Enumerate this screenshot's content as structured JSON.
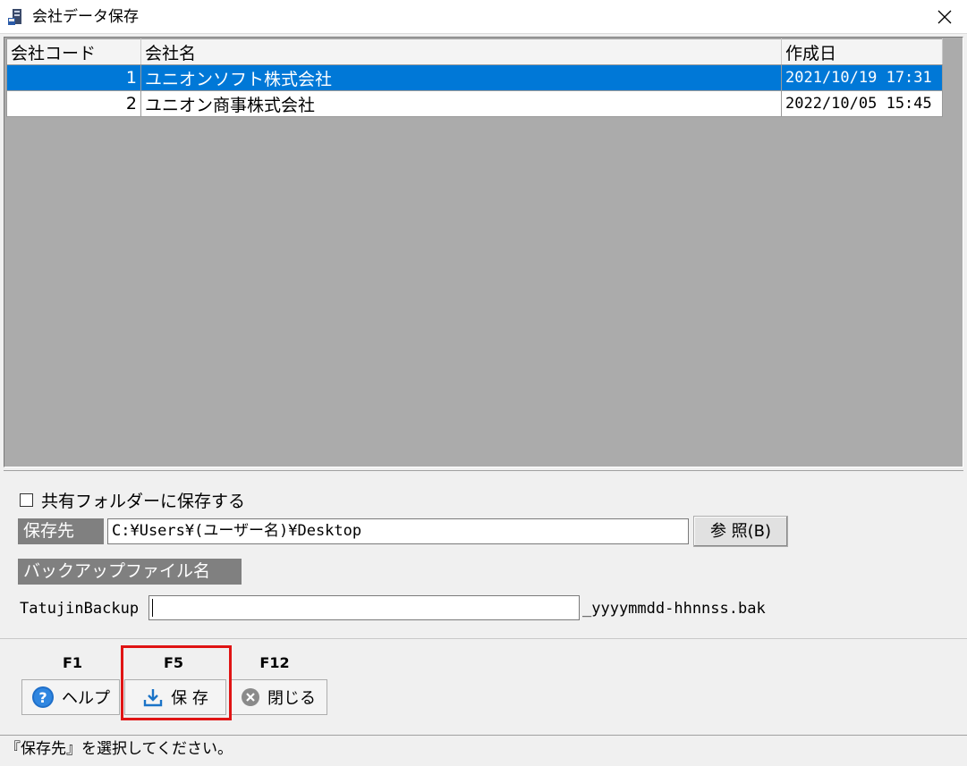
{
  "window": {
    "title": "会社データ保存"
  },
  "grid": {
    "headers": {
      "code": "会社コード",
      "name": "会社名",
      "date": "作成日"
    },
    "rows": [
      {
        "code": "1",
        "name": "ユニオンソフト株式会社",
        "date": "2021/10/19 17:31",
        "selected": true
      },
      {
        "code": "2",
        "name": "ユニオン商事株式会社",
        "date": "2022/10/05 15:45",
        "selected": false
      }
    ]
  },
  "options": {
    "shared_folder_label": "共有フォルダーに保存する",
    "shared_folder_checked": false,
    "destination_label": "保存先",
    "destination_value": "C:¥Users¥(ユーザー名)¥Desktop",
    "browse_label": "参 照(B)",
    "backup_name_label": "バックアップファイル名",
    "backup_prefix": "TatujinBackup",
    "backup_name_value": "",
    "backup_suffix": "_yyyymmdd-hhnnss.bak"
  },
  "function_keys": {
    "f1": {
      "key": "F1",
      "label": "ヘルプ",
      "icon": "help-icon"
    },
    "f5": {
      "key": "F5",
      "label": "保 存",
      "icon": "download-icon"
    },
    "f12": {
      "key": "F12",
      "label": "閉じる",
      "icon": "close-circle-icon"
    }
  },
  "status": {
    "message": "『保存先』を選択してください。"
  },
  "colors": {
    "selection": "#0078d7",
    "highlight": "#e01414",
    "grid_background": "#ababab",
    "label_background": "#808080"
  }
}
